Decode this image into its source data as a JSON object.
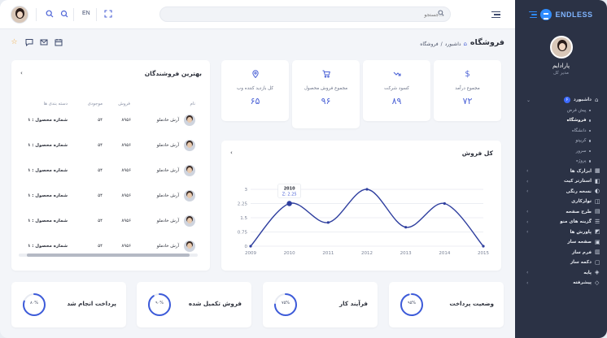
{
  "topbar": {
    "lang": "EN",
    "search_placeholder": "جستجو..."
  },
  "sidebar": {
    "brand": "ENDLESS",
    "user_name": "پارادایم",
    "user_role": "مدیر کل",
    "dashboard": {
      "label": "داشبورد",
      "badge": "۶"
    },
    "sub_items": [
      {
        "label": "پیش فرض",
        "active": false
      },
      {
        "label": "فروشگاه",
        "active": true
      },
      {
        "label": "دانشگاه",
        "active": false
      },
      {
        "label": "کریپتو",
        "active": false
      },
      {
        "label": "سرور",
        "active": false
      },
      {
        "label": "پروژه",
        "active": false
      }
    ],
    "items": [
      {
        "label": "ابزارک ها",
        "chev": true
      },
      {
        "label": "استارتر کیت",
        "chev": true
      },
      {
        "label": "نسخه رنگی",
        "chev": true
      },
      {
        "label": "تولزکاری",
        "chev": false
      },
      {
        "label": "طرح صفحه",
        "chev": true
      },
      {
        "label": "گزینه های منو",
        "chev": true
      },
      {
        "label": "پاورش ها",
        "chev": true
      },
      {
        "label": "صفحه ساز",
        "chev": false
      },
      {
        "label": "فرم ساز",
        "chev": false
      },
      {
        "label": "دکمه ساز",
        "chev": false
      },
      {
        "label": "پایه",
        "chev": true
      },
      {
        "label": "پیشرفته",
        "chev": true
      }
    ]
  },
  "page": {
    "title": "فروشگاه",
    "breadcrumb": [
      "داشبورد",
      "فروشگاه"
    ]
  },
  "stats": [
    {
      "label": "مجموع درآمد",
      "value": "۷۲",
      "icon": "dollar-icon"
    },
    {
      "label": "کسود شرکت",
      "value": "۸۹",
      "icon": "trend-down-icon"
    },
    {
      "label": "مجموع فروش محصول",
      "value": "۹۶",
      "icon": "cart-icon"
    },
    {
      "label": "کل بازدید کننده وب",
      "value": "۶۵",
      "icon": "map-pin-icon"
    }
  ],
  "sales_chart": {
    "title": "کل فروش",
    "tooltip_title": "2010",
    "tooltip_value": "Z: 2.25"
  },
  "chart_data": {
    "type": "line",
    "title": "کل فروش",
    "x": [
      2009,
      2010,
      2011,
      2012,
      2013,
      2014,
      2015
    ],
    "y": [
      0,
      2.25,
      1.25,
      3,
      1,
      2.25,
      0
    ],
    "ylim": [
      0,
      3
    ],
    "yticks": [
      "3",
      "2.25",
      "1.5",
      "0.75",
      "0"
    ],
    "xticks": [
      "2009",
      "2010",
      "2011",
      "2012",
      "2013",
      "2014",
      "2015"
    ],
    "grid": true,
    "color": "#2f3f9f"
  },
  "sellers": {
    "title": "بهترین فروشندگان",
    "columns": [
      "نام",
      "فروش",
      "موجودی",
      "دسته بندی ها"
    ],
    "rows": [
      {
        "name": "آرش خادملو",
        "sales": "۸۹۵۶",
        "stock": "۵۴",
        "category": "شماره محصول : ۱"
      },
      {
        "name": "آرش خادملو",
        "sales": "۸۹۵۶",
        "stock": "۵۴",
        "category": "شماره محصول : ۱"
      },
      {
        "name": "آرش خادملو",
        "sales": "۸۹۵۶",
        "stock": "۵۴",
        "category": "شماره محصول : ۱"
      },
      {
        "name": "آرش خادملو",
        "sales": "۸۹۵۶",
        "stock": "۵۴",
        "category": "شماره محصول : ۱"
      },
      {
        "name": "آرش خادملو",
        "sales": "۸۹۵۶",
        "stock": "۵۴",
        "category": "شماره محصول : ۱"
      },
      {
        "name": "آرش خادملو",
        "sales": "۸۹۵۶",
        "stock": "۵۴",
        "category": "شماره محصول : ۱"
      }
    ]
  },
  "progress": [
    {
      "label": "وضعیت پرداخت",
      "pct": "۹۵%",
      "value": 0.95
    },
    {
      "label": "فرآیند کار",
      "pct": "۷۵%",
      "value": 0.75
    },
    {
      "label": "فروش تکمیل شده",
      "pct": "۹۰%",
      "value": 0.9
    },
    {
      "label": "پرداخت انجام شد",
      "pct": "۸۰%",
      "value": 0.8
    }
  ]
}
